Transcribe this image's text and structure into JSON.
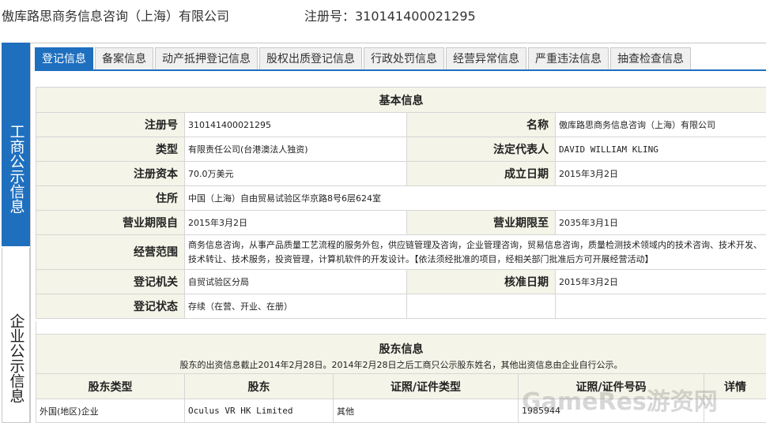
{
  "header": {
    "company_name": "傲库路思商务信息咨询（上海）有限公司",
    "reg_label": "注册号：310141400021295"
  },
  "side": {
    "top_label": "工商公示信息",
    "bottom_label": "企业公示信息"
  },
  "tabs": [
    {
      "label": "登记信息",
      "active": true
    },
    {
      "label": "备案信息"
    },
    {
      "label": "动产抵押登记信息"
    },
    {
      "label": "股权出质登记信息"
    },
    {
      "label": "行政处罚信息"
    },
    {
      "label": "经营异常信息"
    },
    {
      "label": "严重违法信息"
    },
    {
      "label": "抽查检查信息"
    }
  ],
  "basic": {
    "title": "基本信息",
    "reg_no_label": "注册号",
    "reg_no": "310141400021295",
    "name_label": "名称",
    "name": "傲库路思商务信息咨询（上海）有限公司",
    "type_label": "类型",
    "type": "有限责任公司(台港澳法人独资)",
    "legal_rep_label": "法定代表人",
    "legal_rep": "DAVID WILLIAM KLING",
    "capital_label": "注册资本",
    "capital": "70.0万美元",
    "founded_label": "成立日期",
    "founded": "2015年3月2日",
    "address_label": "住所",
    "address": "中国（上海）自由贸易试验区华京路8号6层624室",
    "term_from_label": "营业期限自",
    "term_from": "2015年3月2日",
    "term_to_label": "营业期限至",
    "term_to": "2035年3月1日",
    "scope_label": "经营范围",
    "scope": "商务信息咨询，从事产品质量工艺流程的服务外包，供应链管理及咨询，企业管理咨询，贸易信息咨询，质量检测技术领域内的技术咨询、技术开发、技术转让、技术服务，投资管理，计算机软件的开发设计。【依法须经批准的项目，经相关部门批准后方可开展经营活动】",
    "authority_label": "登记机关",
    "authority": "自贸试验区分局",
    "approved_label": "核准日期",
    "approved": "2015年3月2日",
    "status_label": "登记状态",
    "status": "存续（在营、开业、在册）"
  },
  "shareholders": {
    "title": "股东信息",
    "note": "股东的出资信息截止2014年2月28日。2014年2月28日之后工商只公示股东姓名，其他出资信息由企业自行公示。",
    "columns": [
      "股东类型",
      "股东",
      "证照/证件类型",
      "证照/证件号码",
      "详情"
    ],
    "rows": [
      {
        "type": "外国(地区)企业",
        "name": "Oculus VR HK Limited",
        "id_type": "其他",
        "id_no": "1985944",
        "detail": ""
      }
    ]
  },
  "watermark": "GameRes游资网"
}
